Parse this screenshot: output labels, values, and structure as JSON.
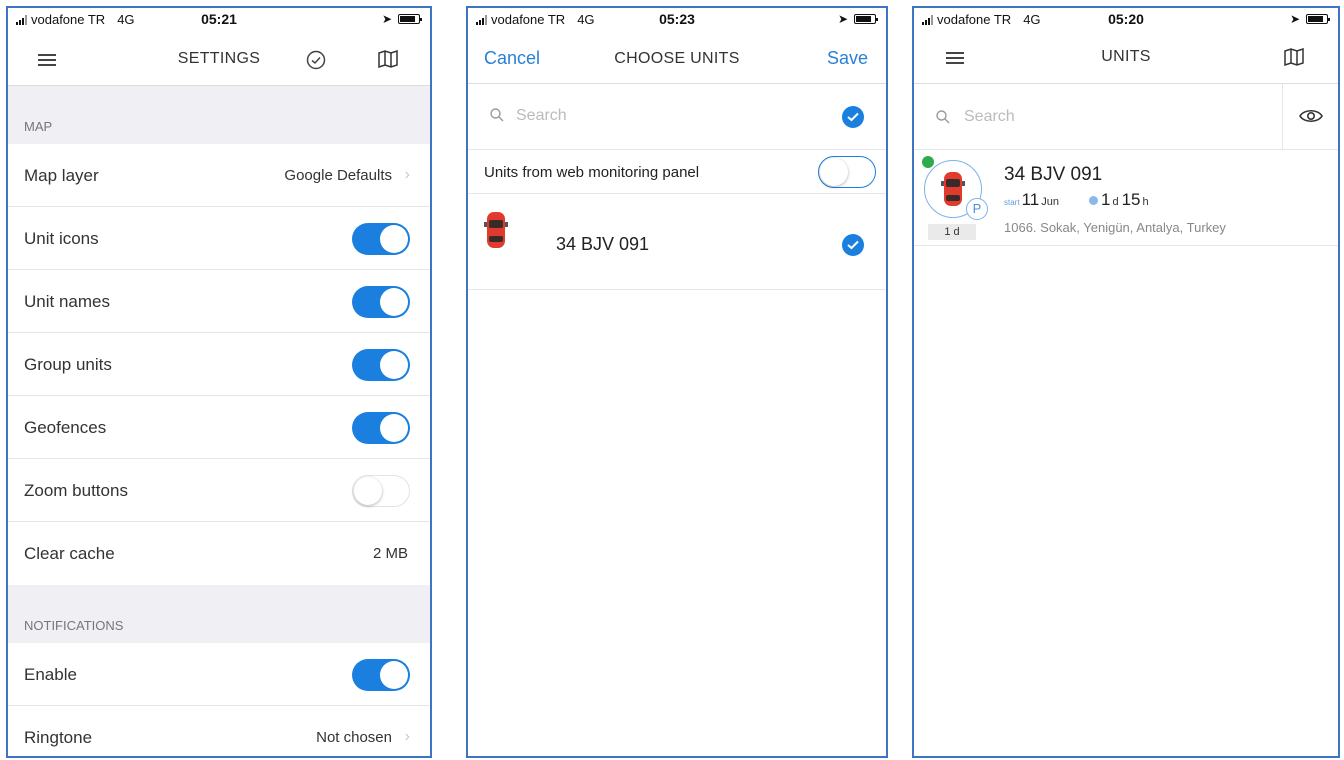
{
  "statusbar": {
    "carrier": "vodafone TR",
    "network": "4G",
    "times": [
      "05:21",
      "05:23",
      "05:20"
    ]
  },
  "settings": {
    "title": "SETTINGS",
    "sections": {
      "map": "MAP",
      "notifications": "NOTIFICATIONS"
    },
    "rows": {
      "map_layer": {
        "label": "Map layer",
        "value": "Google Defaults"
      },
      "unit_icons": {
        "label": "Unit icons",
        "on": true
      },
      "unit_names": {
        "label": "Unit names",
        "on": true
      },
      "group_units": {
        "label": "Group units",
        "on": true
      },
      "geofences": {
        "label": "Geofences",
        "on": true
      },
      "zoom_buttons": {
        "label": "Zoom buttons",
        "on": false
      },
      "clear_cache": {
        "label": "Clear cache",
        "value": "2 MB"
      },
      "enable": {
        "label": "Enable",
        "on": true
      },
      "ringtone": {
        "label": "Ringtone",
        "value": "Not chosen"
      }
    }
  },
  "choose_units": {
    "title": "CHOOSE UNITS",
    "cancel_label": "Cancel",
    "save_label": "Save",
    "search_placeholder": "Search",
    "web_panel_label": "Units from web monitoring panel",
    "web_panel_on": false,
    "unit_name": "34 BJV 091",
    "unit_selected": true
  },
  "units": {
    "title": "UNITS",
    "search_placeholder": "Search",
    "card": {
      "name": "34 BJV 091",
      "start_label": "start",
      "start_day": "11",
      "start_month": "Jun",
      "duration_days": "1",
      "duration_days_unit": "d",
      "duration_hours": "15",
      "duration_hours_unit": "h",
      "day_badge": "1 d",
      "parking_badge": "P",
      "address": "1066. Sokak, Yenigün, Antalya, Turkey"
    }
  },
  "colors": {
    "accent": "#1b7fe0",
    "frame_border": "#3f74c4",
    "section_bg": "#efeff4",
    "status_green": "#2eaa4a"
  },
  "icons": [
    "hamburger-icon",
    "check-circle-icon",
    "map-icon",
    "search-icon",
    "eye-icon",
    "car-icon",
    "chevron-right-icon",
    "location-arrow-icon",
    "battery-icon",
    "signal-icon"
  ]
}
